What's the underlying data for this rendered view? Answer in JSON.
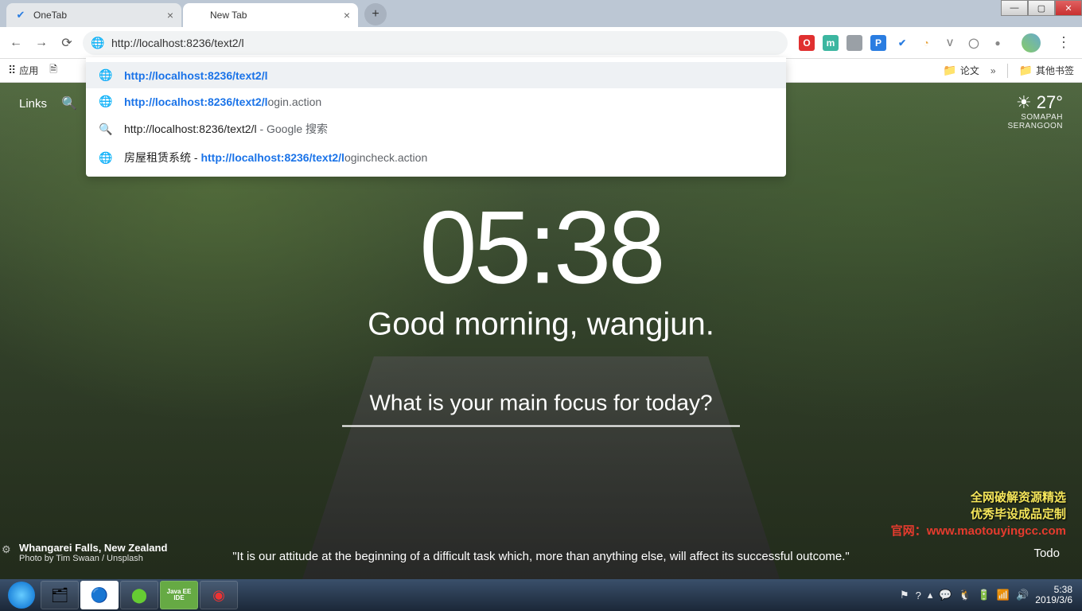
{
  "tabs": [
    {
      "title": "OneTab",
      "favicon_color": "#2a7de1"
    },
    {
      "title": "New Tab",
      "favicon_color": "#888"
    }
  ],
  "active_tab_index": 1,
  "omnibox": {
    "value": "http://localhost:8236/text2/l"
  },
  "suggestions": [
    {
      "icon": "globe",
      "html": "<span class='url-part'>http://localhost:8236/text2/l</span>",
      "hl": true
    },
    {
      "icon": "globe",
      "html": "<span class='url-part'>http://localhost:8236/text2/l</span><span class='grey'>ogin.action</span>"
    },
    {
      "icon": "search",
      "html": "<span class='black'>http://localhost:8236/text2/l</span> <span class='grey'>- Google 搜索</span>"
    },
    {
      "icon": "globe",
      "html": "<span class='black'>房屋租赁系统 - </span><span class='url-part'>http://localhost:8236/text2/l</span><span class='grey'>ogincheck.action</span>"
    }
  ],
  "bookmarks_bar": {
    "apps_label": "应用",
    "right_folders": [
      "论文",
      "其他书签"
    ],
    "chevron": "»"
  },
  "extension_icons": [
    {
      "bg": "#e03030",
      "fg": "#fff",
      "txt": "O"
    },
    {
      "bg": "#3cb6a0",
      "fg": "#fff",
      "txt": "m"
    },
    {
      "bg": "#9aa0a6",
      "fg": "#fff",
      "txt": ""
    },
    {
      "bg": "#2a7de1",
      "fg": "#fff",
      "txt": "P"
    },
    {
      "bg": "#fff",
      "fg": "#2a7de1",
      "txt": "✔"
    },
    {
      "bg": "#fff",
      "fg": "#e8a33d",
      "txt": "◔"
    },
    {
      "bg": "#fff",
      "fg": "#888",
      "txt": "V"
    },
    {
      "bg": "#fff",
      "fg": "#888",
      "txt": "◯"
    },
    {
      "bg": "#fff",
      "fg": "#888",
      "txt": "●"
    }
  ],
  "momentum": {
    "links_label": "Links",
    "clock": "05:38",
    "greeting": "Good morning, wangjun.",
    "focus_question": "What is your main focus for today?",
    "weather": {
      "temp": "27°",
      "location1": "SOMAPAH",
      "location2": "SERANGOON"
    },
    "credit": {
      "location": "Whangarei Falls, New Zealand",
      "byline": "Photo by Tim Swaan / Unsplash"
    },
    "quote": "\"It is our attitude at the beginning of a difficult task which, more than anything else, will affect its successful outcome.\"",
    "todo_label": "Todo"
  },
  "promo": {
    "line1": "全网破解资源精选",
    "line2": "优秀毕设成品定制",
    "line3_label": "官网：",
    "line3_url": "www.maotouyingcc.com"
  },
  "taskbar": {
    "time": "5:38",
    "date": "2019/3/6"
  }
}
